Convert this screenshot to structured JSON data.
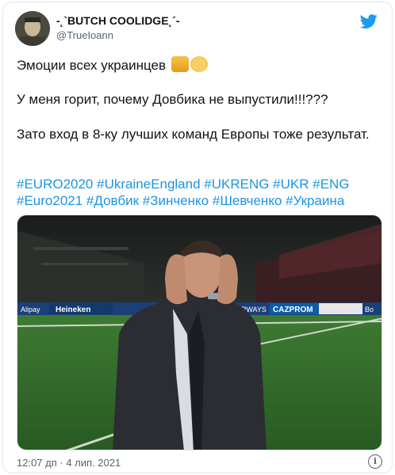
{
  "tweet": {
    "author_name": "-˛`BUTCH COOLIDGE˛´-",
    "author_handle": "@TrueIoann",
    "line1": "Эмоции всех украинцев",
    "line1_emojis": [
      "scream-cat-emoji",
      "scream-face-emoji"
    ],
    "line2": "У меня горит, почему Довбика не выпустили!!!???",
    "line3": "Зато вход в 8-ку лучших команд Европы тоже результат.",
    "hashtags_line1": "#EURO2020 #UkraineEngland  #UKRENG #UKR #ENG",
    "hashtags_line2": "#Euro2021 #Довбик #Зинченко #Шевченко #Украина",
    "timestamp": "12:07 дп · 4 лип. 2021",
    "ad_boards": [
      "Alipay",
      "Heineken",
      "RWAYS",
      "CAZPROM",
      "Bo"
    ]
  },
  "colors": {
    "link": "#1b95e0",
    "twitter_blue": "#1d9bf0",
    "muted": "#536471",
    "pitch": "#2f6d2a"
  },
  "icons": {
    "brand": "twitter-bird-icon",
    "info": "info-icon"
  }
}
